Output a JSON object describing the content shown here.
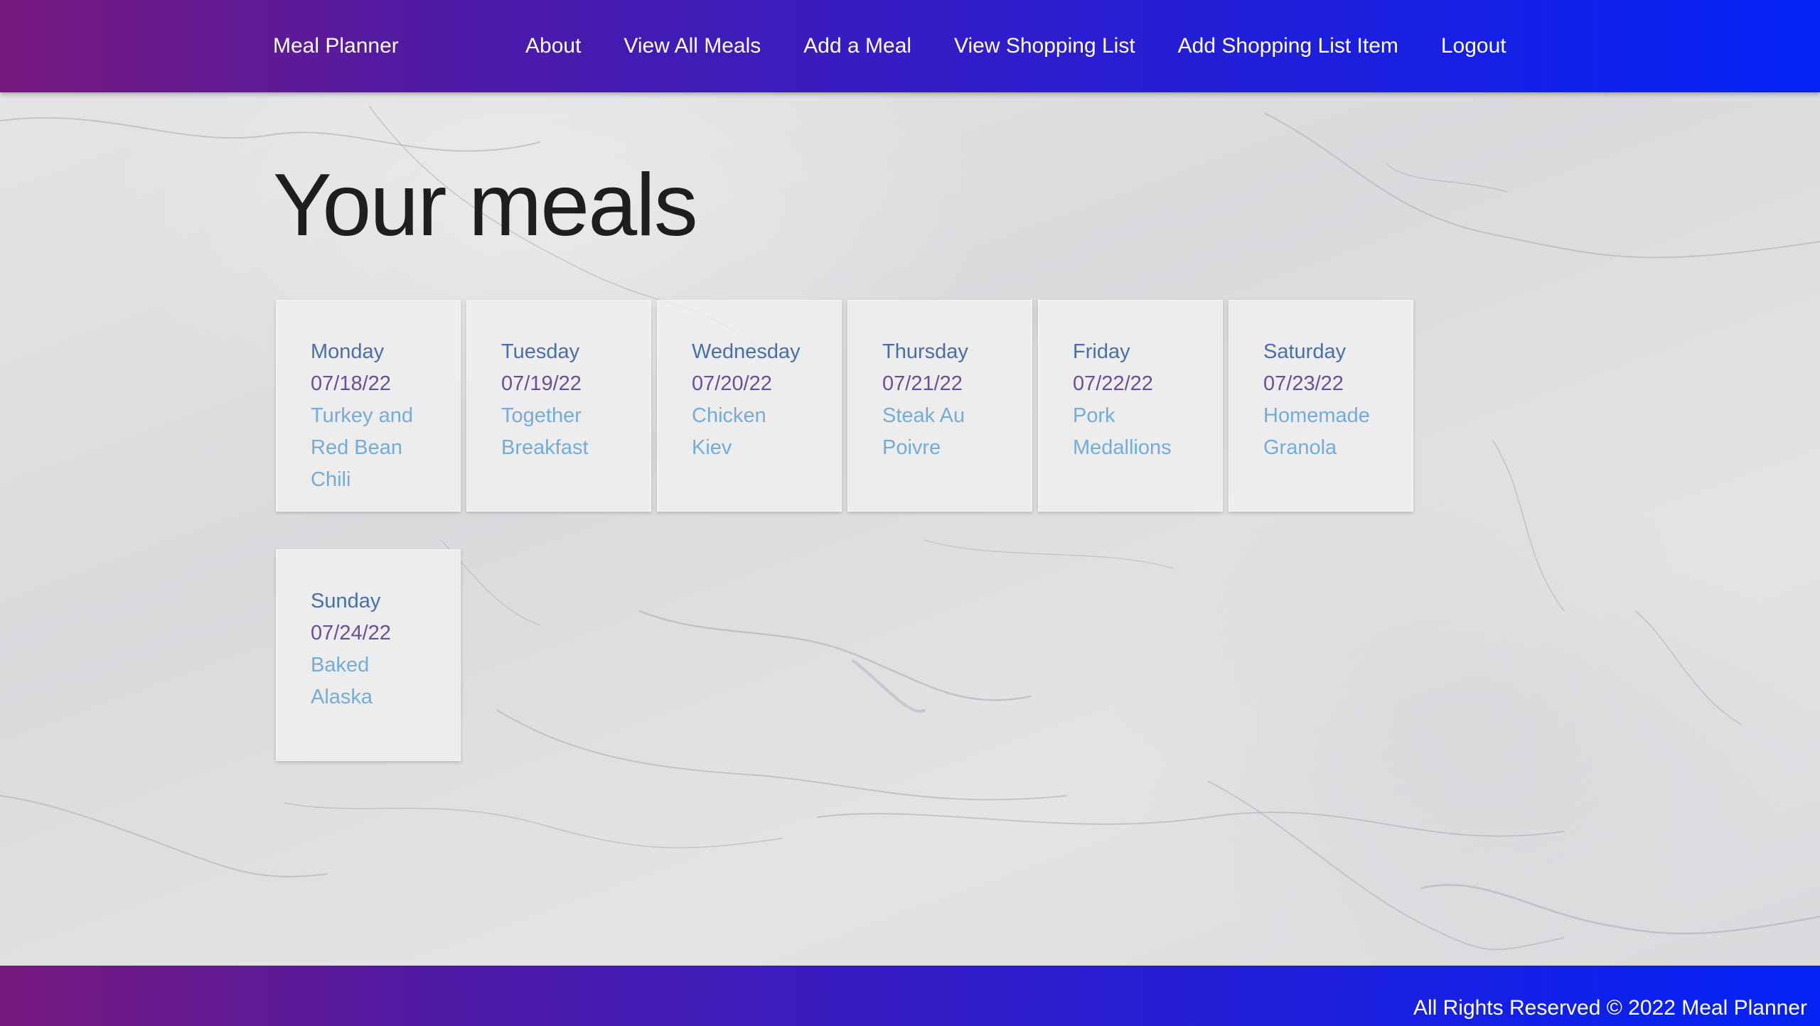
{
  "nav": {
    "brand": "Meal Planner",
    "links": [
      {
        "label": "About"
      },
      {
        "label": "View All Meals"
      },
      {
        "label": "Add a Meal"
      },
      {
        "label": "View Shopping List"
      },
      {
        "label": "Add Shopping List Item"
      },
      {
        "label": "Logout"
      }
    ]
  },
  "main": {
    "title": "Your meals",
    "meals": [
      {
        "day": "Monday",
        "date": "07/18/22",
        "meal": "Turkey and Red Bean Chili"
      },
      {
        "day": "Tuesday",
        "date": "07/19/22",
        "meal": "Together Breakfast"
      },
      {
        "day": "Wednesday",
        "date": "07/20/22",
        "meal": "Chicken Kiev"
      },
      {
        "day": "Thursday",
        "date": "07/21/22",
        "meal": "Steak Au Poivre"
      },
      {
        "day": "Friday",
        "date": "07/22/22",
        "meal": "Pork Medallions"
      },
      {
        "day": "Saturday",
        "date": "07/23/22",
        "meal": "Homemade Granola"
      },
      {
        "day": "Sunday",
        "date": "07/24/22",
        "meal": "Baked Alaska"
      }
    ]
  },
  "footer": {
    "text": "All Rights Reserved © 2022 Meal Planner"
  },
  "colors": {
    "nav_gradient_start": "#76197e",
    "nav_gradient_end": "#0322f6",
    "day_text": "#4a6fa8",
    "date_text": "#6b4f96",
    "meal_text": "#74acd9",
    "title_text": "#1e1e1f"
  }
}
